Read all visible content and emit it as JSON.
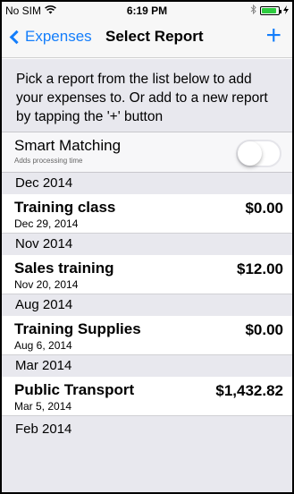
{
  "status": {
    "carrier": "No SIM",
    "time": "6:19 PM",
    "wifi_icon": "wifi-icon",
    "bluetooth_icon": "bluetooth-icon"
  },
  "navbar": {
    "back_label": "Expenses",
    "title": "Select Report",
    "add_label": "+"
  },
  "instructions": "Pick a report from the list below to add your expenses to.  Or add to a new report by tapping the '+' button",
  "smart_matching": {
    "label": "Smart Matching",
    "sublabel": "Adds processing time",
    "enabled": false
  },
  "sections": [
    {
      "header": "Dec 2014",
      "items": [
        {
          "name": "Training class",
          "date": "Dec 29, 2014",
          "amount": "$0.00"
        }
      ]
    },
    {
      "header": "Nov 2014",
      "items": [
        {
          "name": "Sales training",
          "date": "Nov 20, 2014",
          "amount": "$12.00"
        }
      ]
    },
    {
      "header": "Aug 2014",
      "items": [
        {
          "name": "Training Supplies",
          "date": "Aug 6, 2014",
          "amount": "$0.00"
        }
      ]
    },
    {
      "header": "Mar 2014",
      "items": [
        {
          "name": "Public Transport",
          "date": "Mar 5, 2014",
          "amount": "$1,432.82"
        }
      ]
    },
    {
      "header": "Feb 2014",
      "items": []
    }
  ],
  "colors": {
    "accent": "#147efb",
    "battery": "#2ecc40"
  }
}
